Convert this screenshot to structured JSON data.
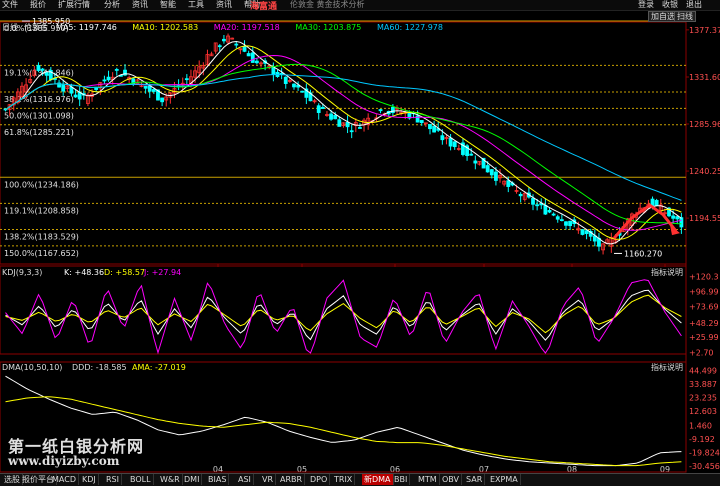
{
  "menu": {
    "items": [
      "文件",
      "报价",
      "扩展行情",
      "分析",
      "资讯",
      "智能",
      "工具",
      "资讯",
      "帮助"
    ],
    "brand": "海富通",
    "title": "伦敦金 黄金技术分析",
    "right_items": [
      "登录",
      "收银",
      "退出"
    ]
  },
  "header": {
    "period": "日线",
    "symbol": "伦敦金",
    "ma_labels": [
      {
        "text": "MA5: 1197.746",
        "color": "#ffffff"
      },
      {
        "text": "MA10: 1202.583",
        "color": "#ffff00"
      },
      {
        "text": "MA20: 1197.518",
        "color": "#ff00ff"
      },
      {
        "text": "MA30: 1203.875",
        "color": "#00ff00"
      },
      {
        "text": "MA60: 1227.978",
        "color": "#00c8ff"
      }
    ],
    "buttons": [
      "加自选",
      "扫线"
    ]
  },
  "kdj": {
    "label": "KDJ(9,3,3)",
    "k": "K: +48.36",
    "d": "D: +58.57",
    "j": "J: +27.94",
    "button": "指标说明",
    "ticks": [
      "+120.3",
      "+96.99",
      "+73.69",
      "+48.29",
      "+25.99",
      "+2.70"
    ]
  },
  "dma": {
    "label": "DMA(10,50,10)",
    "ddd": "DDD: -18.585",
    "ama": "AMA: -27.019",
    "button": "指标说明",
    "ticks": [
      "44.499",
      "33.887",
      "23.235",
      "12.603",
      "1.460",
      "-9.192",
      "-19.824",
      "-30.456"
    ]
  },
  "tabs": [
    "选股",
    "报价平台",
    "MACD",
    "KDJ",
    "RSI",
    "BOLL",
    "W&R",
    "DMI",
    "BIAS",
    "ASI",
    "VR",
    "ARBR",
    "DPO",
    "TRIX",
    "新DMA",
    "BBI",
    "MTM",
    "OBV",
    "SAR",
    "EXPMA"
  ],
  "active_tab": "新DMA",
  "watermark": {
    "line1": "第一纸白银分析网",
    "line2": "www.diyizby.com"
  },
  "colors": {
    "up": "#ff3030",
    "down": "#00ffff",
    "ma5": "#ffffff",
    "ma10": "#ffff00",
    "ma20": "#ff00ff",
    "ma30": "#00ff00",
    "ma60": "#00c8ff",
    "fib": "#c8a000",
    "arrow": "#ff3030"
  },
  "chart_data": {
    "type": "candlestick",
    "months": [
      "04",
      "05",
      "06",
      "07",
      "08",
      "09"
    ],
    "y_ticks": [
      1377.372,
      1331.601,
      1285.963,
      1240.251,
      1194.55
    ],
    "ylim": [
      1150,
      1385
    ],
    "high_label": "1385.950",
    "low_label": "1160.270",
    "fib_levels": [
      {
        "label": "0.0%(1385.950)",
        "value": 1385.95
      },
      {
        "label": "19.1%(1342.846)",
        "value": 1342.846
      },
      {
        "label": "38.2%(1316.976)",
        "value": 1316.976
      },
      {
        "label": "50.0%(1301.098)",
        "value": 1301.098
      },
      {
        "label": "61.8%(1285.221)",
        "value": 1285.221
      },
      {
        "label": "100.0%(1234.186)",
        "value": 1234.186
      },
      {
        "label": "119.1%(1208.858)",
        "value": 1208.858
      },
      {
        "label": "138.2%(1183.529)",
        "value": 1183.529
      },
      {
        "label": "150.0%(1167.652)",
        "value": 1167.652
      }
    ],
    "close_anchors": [
      1300,
      1320,
      1342,
      1330,
      1318,
      1310,
      1325,
      1338,
      1330,
      1320,
      1310,
      1322,
      1335,
      1355,
      1370,
      1360,
      1345,
      1338,
      1325,
      1315,
      1300,
      1290,
      1282,
      1290,
      1300,
      1298,
      1294,
      1282,
      1270,
      1262,
      1250,
      1238,
      1225,
      1215,
      1205,
      1198,
      1188,
      1178,
      1165,
      1180,
      1200,
      1210,
      1200,
      1188
    ],
    "kdj": {
      "ylim": [
        0,
        130
      ],
      "anchors_k": [
        60,
        45,
        75,
        40,
        70,
        35,
        80,
        50,
        85,
        30,
        70,
        40,
        90,
        55,
        30,
        80,
        45,
        65,
        20,
        70,
        90,
        45,
        30,
        75,
        40,
        85,
        35,
        60,
        80,
        30,
        70,
        50,
        20,
        65,
        85,
        35,
        55,
        90,
        100,
        70,
        48
      ],
      "anchors_d": [
        58,
        52,
        65,
        50,
        62,
        48,
        68,
        56,
        72,
        45,
        62,
        50,
        78,
        60,
        42,
        70,
        52,
        60,
        35,
        62,
        78,
        55,
        40,
        68,
        48,
        75,
        45,
        58,
        72,
        42,
        64,
        54,
        32,
        60,
        75,
        45,
        55,
        80,
        92,
        72,
        58
      ]
    },
    "dma": {
      "ylim": [
        -35,
        48
      ],
      "anchors_ddd": [
        40,
        30,
        22,
        15,
        10,
        12,
        6,
        -2,
        -6,
        -3,
        2,
        8,
        4,
        -3,
        -8,
        -12,
        -10,
        -4,
        0,
        -6,
        -12,
        -18,
        -22,
        -25,
        -27,
        -28,
        -29,
        -30,
        -30,
        -28,
        -20,
        -19
      ],
      "anchors_ama": [
        20,
        23,
        24,
        22,
        18,
        14,
        10,
        6,
        3,
        1,
        0,
        2,
        4,
        3,
        0,
        -4,
        -8,
        -11,
        -12,
        -12,
        -14,
        -17,
        -20,
        -23,
        -25,
        -27,
        -28,
        -29,
        -30,
        -30,
        -28,
        -27
      ]
    }
  }
}
